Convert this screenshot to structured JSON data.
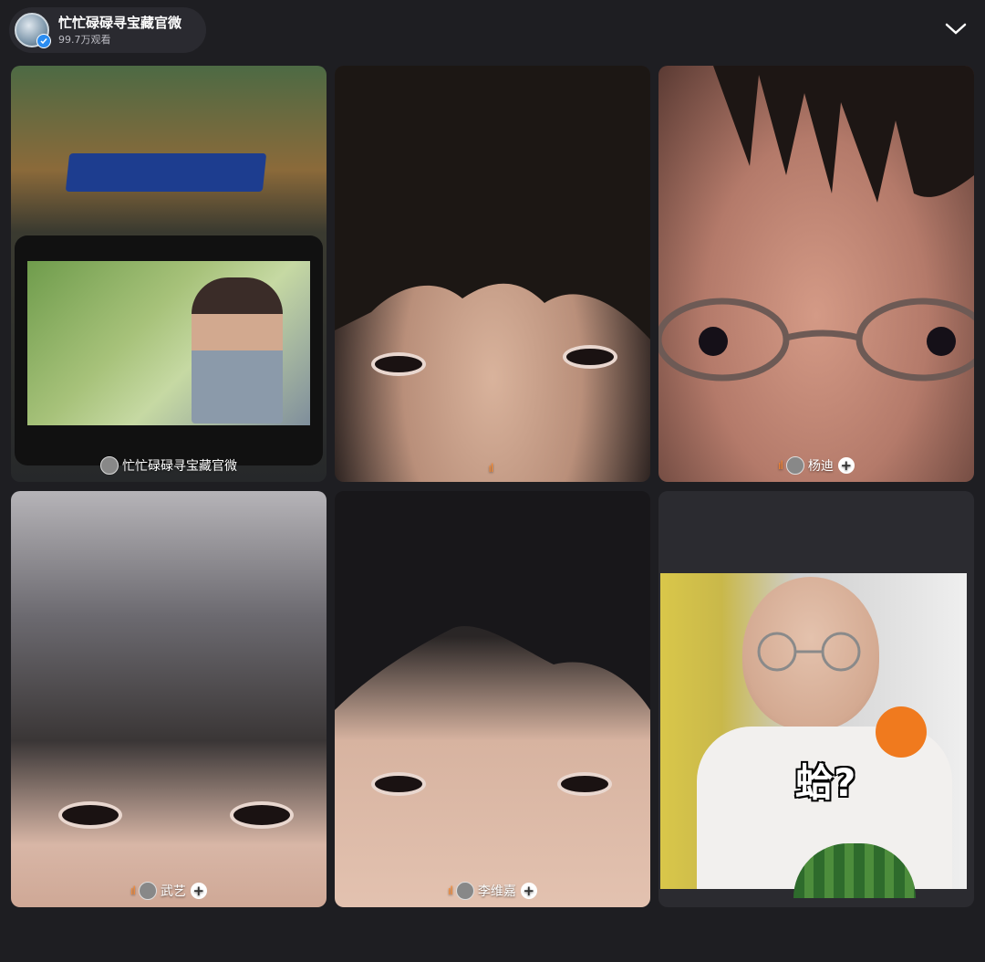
{
  "header": {
    "title": "忙忙碌碌寻宝藏官微",
    "viewers": "99.7万观看",
    "avatar_icon": "channel-avatar",
    "verified_icon": "verified-badge-icon",
    "collapse_icon": "chevron-down-icon"
  },
  "tiles": [
    {
      "label": "忙忙碌碌寻宝藏官微",
      "show_plus": false,
      "show_live": false
    },
    {
      "label": "",
      "show_plus": false,
      "show_live": true
    },
    {
      "label": "杨迪",
      "show_plus": true,
      "show_live": true
    },
    {
      "label": "武艺",
      "show_plus": true,
      "show_live": true
    },
    {
      "label": "李维嘉",
      "show_plus": true,
      "show_live": true
    },
    {
      "label": "",
      "caption": "蛤?",
      "show_plus": false,
      "show_live": false
    }
  ],
  "plus_symbol": "+",
  "live_symbol": "ıl",
  "colors": {
    "background": "#1e1e22",
    "live_accent": "#ff8a2b",
    "verified": "#2b8cf0"
  }
}
